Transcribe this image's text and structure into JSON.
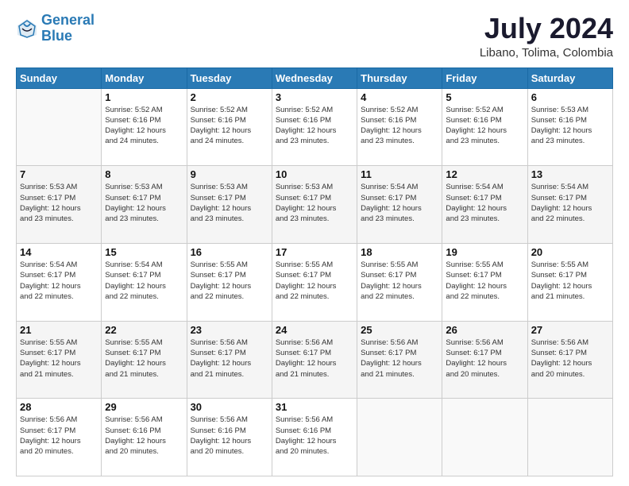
{
  "header": {
    "logo_line1": "General",
    "logo_line2": "Blue",
    "month_year": "July 2024",
    "location": "Libano, Tolima, Colombia"
  },
  "weekdays": [
    "Sunday",
    "Monday",
    "Tuesday",
    "Wednesday",
    "Thursday",
    "Friday",
    "Saturday"
  ],
  "weeks": [
    [
      {
        "day": "",
        "info": ""
      },
      {
        "day": "1",
        "info": "Sunrise: 5:52 AM\nSunset: 6:16 PM\nDaylight: 12 hours\nand 24 minutes."
      },
      {
        "day": "2",
        "info": "Sunrise: 5:52 AM\nSunset: 6:16 PM\nDaylight: 12 hours\nand 24 minutes."
      },
      {
        "day": "3",
        "info": "Sunrise: 5:52 AM\nSunset: 6:16 PM\nDaylight: 12 hours\nand 23 minutes."
      },
      {
        "day": "4",
        "info": "Sunrise: 5:52 AM\nSunset: 6:16 PM\nDaylight: 12 hours\nand 23 minutes."
      },
      {
        "day": "5",
        "info": "Sunrise: 5:52 AM\nSunset: 6:16 PM\nDaylight: 12 hours\nand 23 minutes."
      },
      {
        "day": "6",
        "info": "Sunrise: 5:53 AM\nSunset: 6:16 PM\nDaylight: 12 hours\nand 23 minutes."
      }
    ],
    [
      {
        "day": "7",
        "info": "Sunrise: 5:53 AM\nSunset: 6:17 PM\nDaylight: 12 hours\nand 23 minutes."
      },
      {
        "day": "8",
        "info": "Sunrise: 5:53 AM\nSunset: 6:17 PM\nDaylight: 12 hours\nand 23 minutes."
      },
      {
        "day": "9",
        "info": "Sunrise: 5:53 AM\nSunset: 6:17 PM\nDaylight: 12 hours\nand 23 minutes."
      },
      {
        "day": "10",
        "info": "Sunrise: 5:53 AM\nSunset: 6:17 PM\nDaylight: 12 hours\nand 23 minutes."
      },
      {
        "day": "11",
        "info": "Sunrise: 5:54 AM\nSunset: 6:17 PM\nDaylight: 12 hours\nand 23 minutes."
      },
      {
        "day": "12",
        "info": "Sunrise: 5:54 AM\nSunset: 6:17 PM\nDaylight: 12 hours\nand 23 minutes."
      },
      {
        "day": "13",
        "info": "Sunrise: 5:54 AM\nSunset: 6:17 PM\nDaylight: 12 hours\nand 22 minutes."
      }
    ],
    [
      {
        "day": "14",
        "info": "Sunrise: 5:54 AM\nSunset: 6:17 PM\nDaylight: 12 hours\nand 22 minutes."
      },
      {
        "day": "15",
        "info": "Sunrise: 5:54 AM\nSunset: 6:17 PM\nDaylight: 12 hours\nand 22 minutes."
      },
      {
        "day": "16",
        "info": "Sunrise: 5:55 AM\nSunset: 6:17 PM\nDaylight: 12 hours\nand 22 minutes."
      },
      {
        "day": "17",
        "info": "Sunrise: 5:55 AM\nSunset: 6:17 PM\nDaylight: 12 hours\nand 22 minutes."
      },
      {
        "day": "18",
        "info": "Sunrise: 5:55 AM\nSunset: 6:17 PM\nDaylight: 12 hours\nand 22 minutes."
      },
      {
        "day": "19",
        "info": "Sunrise: 5:55 AM\nSunset: 6:17 PM\nDaylight: 12 hours\nand 22 minutes."
      },
      {
        "day": "20",
        "info": "Sunrise: 5:55 AM\nSunset: 6:17 PM\nDaylight: 12 hours\nand 21 minutes."
      }
    ],
    [
      {
        "day": "21",
        "info": "Sunrise: 5:55 AM\nSunset: 6:17 PM\nDaylight: 12 hours\nand 21 minutes."
      },
      {
        "day": "22",
        "info": "Sunrise: 5:55 AM\nSunset: 6:17 PM\nDaylight: 12 hours\nand 21 minutes."
      },
      {
        "day": "23",
        "info": "Sunrise: 5:56 AM\nSunset: 6:17 PM\nDaylight: 12 hours\nand 21 minutes."
      },
      {
        "day": "24",
        "info": "Sunrise: 5:56 AM\nSunset: 6:17 PM\nDaylight: 12 hours\nand 21 minutes."
      },
      {
        "day": "25",
        "info": "Sunrise: 5:56 AM\nSunset: 6:17 PM\nDaylight: 12 hours\nand 21 minutes."
      },
      {
        "day": "26",
        "info": "Sunrise: 5:56 AM\nSunset: 6:17 PM\nDaylight: 12 hours\nand 20 minutes."
      },
      {
        "day": "27",
        "info": "Sunrise: 5:56 AM\nSunset: 6:17 PM\nDaylight: 12 hours\nand 20 minutes."
      }
    ],
    [
      {
        "day": "28",
        "info": "Sunrise: 5:56 AM\nSunset: 6:17 PM\nDaylight: 12 hours\nand 20 minutes."
      },
      {
        "day": "29",
        "info": "Sunrise: 5:56 AM\nSunset: 6:16 PM\nDaylight: 12 hours\nand 20 minutes."
      },
      {
        "day": "30",
        "info": "Sunrise: 5:56 AM\nSunset: 6:16 PM\nDaylight: 12 hours\nand 20 minutes."
      },
      {
        "day": "31",
        "info": "Sunrise: 5:56 AM\nSunset: 6:16 PM\nDaylight: 12 hours\nand 20 minutes."
      },
      {
        "day": "",
        "info": ""
      },
      {
        "day": "",
        "info": ""
      },
      {
        "day": "",
        "info": ""
      }
    ]
  ]
}
